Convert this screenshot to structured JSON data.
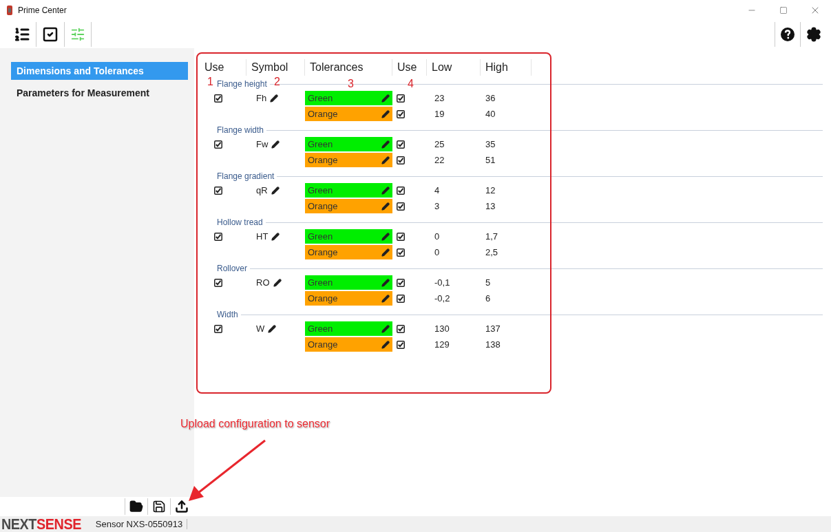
{
  "window": {
    "title": "Prime Center"
  },
  "sidebar": {
    "items": [
      {
        "label": "Dimensions and Tolerances",
        "selected": true
      },
      {
        "label": "Parameters for Measurement",
        "selected": false
      }
    ]
  },
  "table": {
    "columns": [
      "Use",
      "Symbol",
      "Tolerances",
      "Use",
      "Low",
      "High"
    ],
    "groups": [
      {
        "name": "Flange height",
        "checked": true,
        "symbol": "Fh",
        "tolerances": [
          {
            "label": "Green",
            "color": "#00ee00",
            "checked": true,
            "low": "23",
            "high": "36"
          },
          {
            "label": "Orange",
            "color": "#ffa200",
            "checked": true,
            "low": "19",
            "high": "40"
          }
        ]
      },
      {
        "name": "Flange width",
        "checked": true,
        "symbol": "Fw",
        "tolerances": [
          {
            "label": "Green",
            "color": "#00ee00",
            "checked": true,
            "low": "25",
            "high": "35"
          },
          {
            "label": "Orange",
            "color": "#ffa200",
            "checked": true,
            "low": "22",
            "high": "51"
          }
        ]
      },
      {
        "name": "Flange gradient",
        "checked": true,
        "symbol": "qR",
        "tolerances": [
          {
            "label": "Green",
            "color": "#00ee00",
            "checked": true,
            "low": "4",
            "high": "12"
          },
          {
            "label": "Orange",
            "color": "#ffa200",
            "checked": true,
            "low": "3",
            "high": "13"
          }
        ]
      },
      {
        "name": "Hollow tread",
        "checked": true,
        "symbol": "HT",
        "tolerances": [
          {
            "label": "Green",
            "color": "#00ee00",
            "checked": true,
            "low": "0",
            "high": "1,7"
          },
          {
            "label": "Orange",
            "color": "#ffa200",
            "checked": true,
            "low": "0",
            "high": "2,5"
          }
        ]
      },
      {
        "name": "Rollover",
        "checked": true,
        "symbol": "RO",
        "tolerances": [
          {
            "label": "Green",
            "color": "#00ee00",
            "checked": true,
            "low": "-0,1",
            "high": "5"
          },
          {
            "label": "Orange",
            "color": "#ffa200",
            "checked": true,
            "low": "-0,2",
            "high": "6"
          }
        ]
      },
      {
        "name": "Width",
        "checked": true,
        "symbol": "W",
        "tolerances": [
          {
            "label": "Green",
            "color": "#00ee00",
            "checked": true,
            "low": "130",
            "high": "137"
          },
          {
            "label": "Orange",
            "color": "#ffa200",
            "checked": true,
            "low": "129",
            "high": "138"
          }
        ]
      }
    ]
  },
  "annotations": {
    "markers": [
      "1",
      "2",
      "3",
      "4"
    ],
    "callout": "Upload configuration to sensor"
  },
  "status_bar": {
    "logo": [
      {
        "text": "NEXT",
        "color": "#4a4a4a"
      },
      {
        "text": "SENSE",
        "color": "#e0242c"
      }
    ],
    "sensor": "Sensor NXS-0550913"
  }
}
